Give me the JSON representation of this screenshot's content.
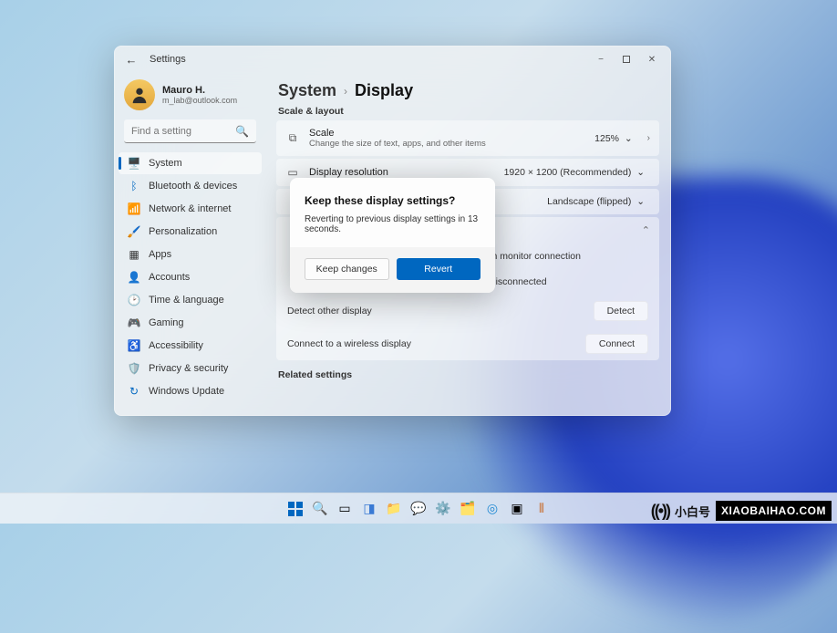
{
  "window": {
    "appTitle": "Settings",
    "minimize": "−",
    "maximize": "□",
    "close": "✕"
  },
  "profile": {
    "name": "Mauro H.",
    "email": "m_lab@outlook.com"
  },
  "search": {
    "placeholder": "Find a setting"
  },
  "nav": {
    "system": "System",
    "bluetooth": "Bluetooth & devices",
    "network": "Network & internet",
    "personalization": "Personalization",
    "apps": "Apps",
    "accounts": "Accounts",
    "time": "Time & language",
    "gaming": "Gaming",
    "accessibility": "Accessibility",
    "privacy": "Privacy & security",
    "update": "Windows Update"
  },
  "breadcrumb": {
    "parent": "System",
    "current": "Display"
  },
  "sections": {
    "scaleLayout": "Scale & layout",
    "related": "Related settings"
  },
  "scale": {
    "title": "Scale",
    "subtitle": "Change the size of text, apps, and other items",
    "value": "125%"
  },
  "resolution": {
    "title": "Display resolution",
    "value": "1920 × 1200 (Recommended)"
  },
  "orientation": {
    "value": "Landscape (flipped)"
  },
  "multi": {
    "remember": "Remember window locations based on monitor connection",
    "minimize": "Minimize windows when a monitor is disconnected",
    "detectLabel": "Detect other display",
    "detectBtn": "Detect",
    "wirelessLabel": "Connect to a wireless display",
    "wirelessBtn": "Connect"
  },
  "modal": {
    "title": "Keep these display settings?",
    "message": "Reverting to previous display settings in 13 seconds.",
    "keep": "Keep changes",
    "revert": "Revert"
  },
  "watermark": {
    "cn": "小白号",
    "url": "XIAOBAIHAO.COM"
  }
}
